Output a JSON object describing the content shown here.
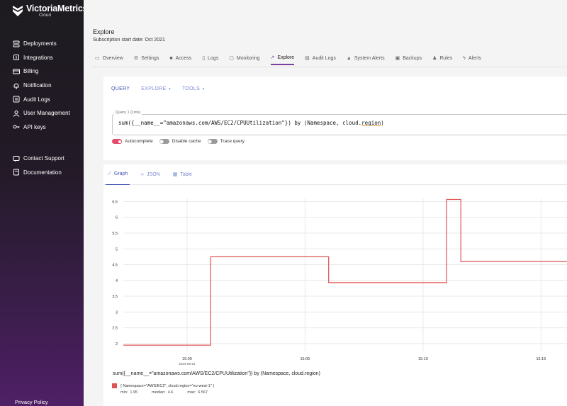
{
  "sidebar": {
    "brand": "VictoriaMetrics",
    "brand_sub": "Cloud",
    "items": [
      {
        "label": "Deployments",
        "icon": "server-icon"
      },
      {
        "label": "Integrations",
        "icon": "plug-icon"
      },
      {
        "label": "Billing",
        "icon": "card-icon"
      },
      {
        "label": "Notification",
        "icon": "bell-icon"
      },
      {
        "label": "Audit Logs",
        "icon": "list-icon"
      },
      {
        "label": "User Management",
        "icon": "users-icon"
      },
      {
        "label": "API keys",
        "icon": "key-icon"
      }
    ],
    "support_items": [
      {
        "label": "Contact Support",
        "icon": "support-icon"
      },
      {
        "label": "Documentation",
        "icon": "book-icon"
      }
    ],
    "privacy": "Privacy Policy"
  },
  "header": {
    "title": "Explore",
    "subtitle": "Subscription start date: Oct 2021"
  },
  "tabs": [
    {
      "label": "Overview",
      "icon": "monitor-icon",
      "active": false
    },
    {
      "label": "Settings",
      "icon": "gear-icon",
      "active": false
    },
    {
      "label": "Access",
      "icon": "lock-icon",
      "active": false
    },
    {
      "label": "Logs",
      "icon": "file-icon",
      "active": false
    },
    {
      "label": "Monitoring",
      "icon": "box-icon",
      "active": false
    },
    {
      "label": "Explore",
      "icon": "chart-icon",
      "active": true
    },
    {
      "label": "Audit Logs",
      "icon": "doc-icon",
      "active": false
    },
    {
      "label": "System Alerts",
      "icon": "warning-icon",
      "active": false
    },
    {
      "label": "Backups",
      "icon": "archive-icon",
      "active": false
    },
    {
      "label": "Rules",
      "icon": "bell-icon",
      "active": false
    },
    {
      "label": "Alerts",
      "icon": "bolt-icon",
      "active": false
    }
  ],
  "query": {
    "tabs": {
      "query": "QUERY",
      "explore": "EXPLORE",
      "tools": "TOOLS"
    },
    "label": "Query 1 (1ms)",
    "text_pre": "sum({__name__=\"amazonaws.com/AWS/EC2/CPUUtilization\"}) by (Namespace, cloud.",
    "text_underlined": "region",
    "text_post": ")",
    "toggles": {
      "autocomplete": "Autocomplete",
      "disable_cache": "Disable cache",
      "trace_query": "Trace query"
    }
  },
  "graph_tabs": {
    "graph": "Graph",
    "json": "JSON",
    "table": "Table"
  },
  "colors": {
    "accent": "#7b3fa0",
    "link": "#3f51b5",
    "series": "#e05353",
    "toggle_on": "#e44a6a"
  },
  "chart_data": {
    "type": "line",
    "title": "",
    "xlabel": "",
    "ylabel": "",
    "ylim": [
      1.75,
      6.6
    ],
    "yticks": [
      "2",
      "2.5",
      "3",
      "3.5",
      "4",
      "4.5",
      "5",
      "5.5",
      "6",
      "6.5"
    ],
    "xticks": [
      {
        "t": 0,
        "label": "15:00",
        "sub": "2024-09-22"
      },
      {
        "t": 5,
        "label": "15:05",
        "sub": ""
      },
      {
        "t": 10,
        "label": "15:10",
        "sub": ""
      },
      {
        "t": 15,
        "label": "15:15",
        "sub": ""
      }
    ],
    "xlim": [
      -2.7,
      16.1
    ],
    "grid": true,
    "series": [
      {
        "name": "{ Namespace=\"AWS/EC2\", cloud.region=\"eu-west-1\" }",
        "points": [
          [
            -2.7,
            1.95
          ],
          [
            1.0,
            1.95
          ],
          [
            1.0,
            4.75
          ],
          [
            6.0,
            4.75
          ],
          [
            6.0,
            3.93
          ],
          [
            11.0,
            3.93
          ],
          [
            11.0,
            6.567
          ],
          [
            11.6,
            6.567
          ],
          [
            11.6,
            4.6
          ],
          [
            16.1,
            4.6
          ]
        ]
      }
    ],
    "legend_title": "sum({__name__=\"amazonaws.com/AWS/EC2/CPUUtilization\"}) by (Namespace, cloud.region)",
    "legend_stats": {
      "min": "1.95",
      "median": "4.6",
      "max": "6.567"
    }
  }
}
